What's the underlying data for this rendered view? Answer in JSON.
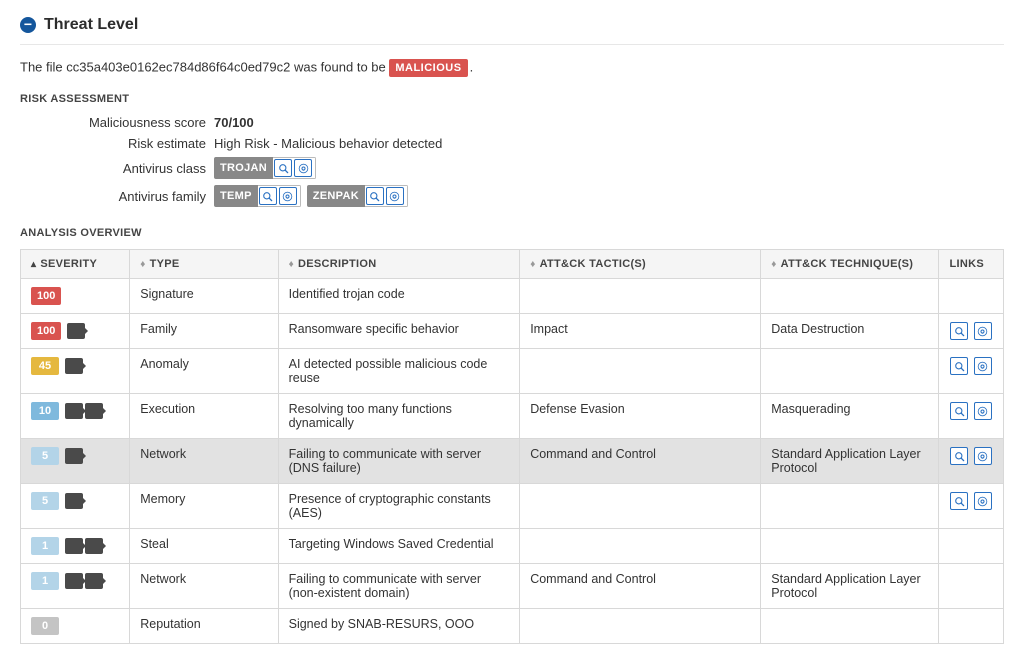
{
  "section": {
    "title": "Threat Level"
  },
  "file_line": {
    "prefix": "The file ",
    "hash": "cc35a403e0162ec784d86f64c0ed79c2",
    "middle": " was found to be ",
    "verdict": "MALICIOUS",
    "suffix": "."
  },
  "risk_heading": "RISK ASSESSMENT",
  "risk": {
    "score_label": "Maliciousness score",
    "score_value": "70/100",
    "estimate_label": "Risk estimate",
    "estimate_value": "High Risk - Malicious behavior detected",
    "av_class_label": "Antivirus class",
    "av_class_tags": [
      "TROJAN"
    ],
    "av_family_label": "Antivirus family",
    "av_family_tags": [
      "TEMP",
      "ZENPAK"
    ]
  },
  "overview_heading": "ANALYSIS OVERVIEW",
  "columns": {
    "severity": "SEVERITY",
    "type": "TYPE",
    "description": "DESCRIPTION",
    "tactics": "ATT&CK TACTIC(S)",
    "techniques": "ATT&CK TECHNIQUE(S)",
    "links": "LINKS"
  },
  "rows": [
    {
      "sev": "100",
      "sev_class": "sev-red",
      "os": 0,
      "type": "Signature",
      "desc": "Identified trojan code",
      "tac": "",
      "tech": "",
      "links": false
    },
    {
      "sev": "100",
      "sev_class": "sev-red",
      "os": 1,
      "type": "Family",
      "desc": "Ransomware specific behavior",
      "tac": "Impact",
      "tech": "Data Destruction",
      "links": true
    },
    {
      "sev": "45",
      "sev_class": "sev-yellow",
      "os": 1,
      "type": "Anomaly",
      "desc": "AI detected possible malicious code reuse",
      "tac": "",
      "tech": "",
      "links": true
    },
    {
      "sev": "10",
      "sev_class": "sev-lblue",
      "os": 2,
      "type": "Execution",
      "desc": "Resolving too many functions dynamically",
      "tac": "Defense Evasion",
      "tech": "Masquerading",
      "links": true
    },
    {
      "sev": "5",
      "sev_class": "sev-vlblue",
      "os": 1,
      "type": "Network",
      "desc": "Failing to communicate with server (DNS failure)",
      "tac": "Command and Control",
      "tech": "Standard Application Layer Protocol",
      "links": true,
      "highlight": true
    },
    {
      "sev": "5",
      "sev_class": "sev-vlblue",
      "os": 1,
      "type": "Memory",
      "desc": "Presence of cryptographic constants (AES)",
      "tac": "",
      "tech": "",
      "links": true
    },
    {
      "sev": "1",
      "sev_class": "sev-vlblue",
      "os": 2,
      "type": "Steal",
      "desc": "Targeting Windows Saved Credential",
      "tac": "",
      "tech": "",
      "links": false
    },
    {
      "sev": "1",
      "sev_class": "sev-vlblue",
      "os": 2,
      "type": "Network",
      "desc": "Failing to communicate with server (non-existent domain)",
      "tac": "Command and Control",
      "tech": "Standard Application Layer Protocol",
      "links": false
    },
    {
      "sev": "0",
      "sev_class": "sev-grey",
      "os": 0,
      "type": "Reputation",
      "desc": "Signed by SNAB-RESURS, OOO",
      "tac": "",
      "tech": "",
      "links": false
    }
  ]
}
